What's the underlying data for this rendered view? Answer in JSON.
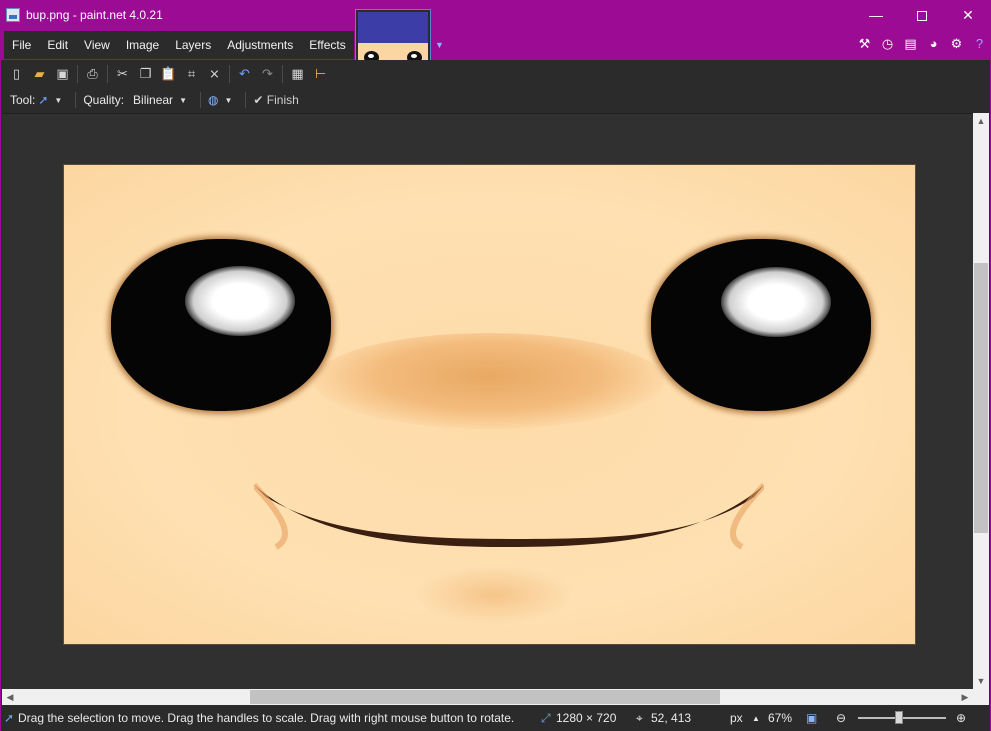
{
  "window": {
    "title": "bup.png - paint.net 4.0.21",
    "minimize_glyph": "—",
    "close_glyph": "✕"
  },
  "menu": {
    "items": [
      "File",
      "Edit",
      "View",
      "Image",
      "Layers",
      "Adjustments",
      "Effects"
    ]
  },
  "title_icons": [
    "tools-icon",
    "history-icon",
    "layers-icon",
    "colors-icon",
    "settings-icon",
    "help-icon"
  ],
  "toolbar": {
    "buttons": [
      "new-icon",
      "open-icon",
      "save-icon",
      "print-icon",
      "cut-icon",
      "copy-icon",
      "paste-icon",
      "crop-icon",
      "deselect-icon",
      "undo-icon",
      "redo-icon",
      "grid-icon",
      "ruler-icon"
    ]
  },
  "tool_options": {
    "tool_label": "Tool:",
    "quality_label": "Quality:",
    "quality_value": "Bilinear",
    "finish_label": "Finish"
  },
  "statusbar": {
    "hint": "Drag the selection to move. Drag the handles to scale. Drag with right mouse button to rotate.",
    "image_size": "1280 × 720",
    "cursor_position": "52, 413",
    "units": "px",
    "zoom": "67%"
  },
  "colors": {
    "title_bar": "#9b0b93",
    "chrome_dark": "#2b2b2b",
    "canvas_skin": "#fedcab",
    "accent_blue": "#5a84c8"
  }
}
